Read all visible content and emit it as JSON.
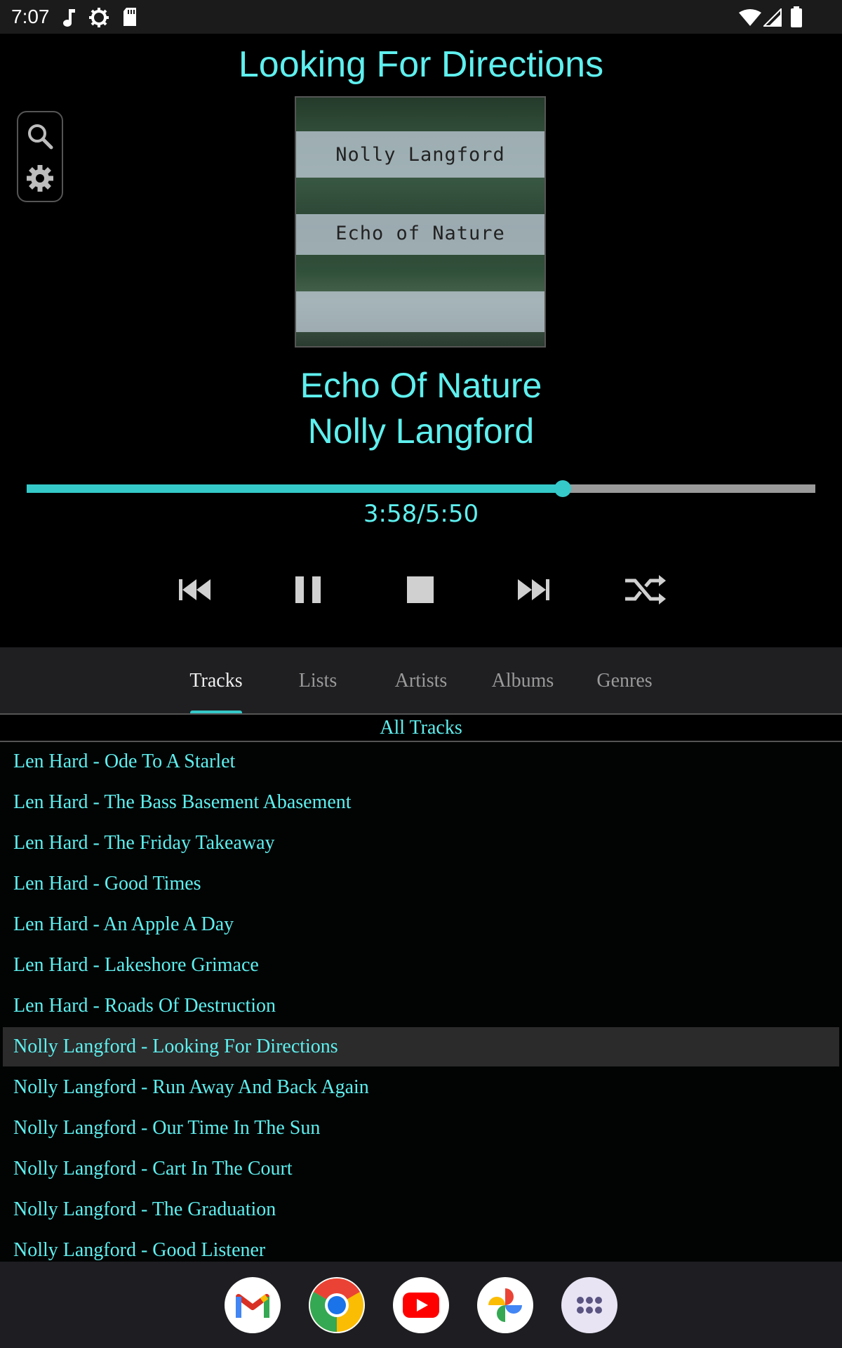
{
  "status_bar": {
    "time": "7:07",
    "left_icons": [
      "music-note-icon",
      "settings-gear-icon",
      "sd-card-icon"
    ],
    "right_icons": [
      "wifi-icon",
      "cell-signal-icon",
      "battery-icon"
    ]
  },
  "now_playing": {
    "heading": "Looking For Directions",
    "album_art": {
      "text_line_1": "Nolly Langford",
      "text_line_2": "Echo of Nature"
    },
    "album": "Echo Of Nature",
    "artist": "Nolly Langford",
    "position_text": "3:58/5:50",
    "progress_fraction": 0.68
  },
  "side_tools": [
    "search-icon",
    "settings-icon"
  ],
  "controls": [
    "previous-icon",
    "pause-icon",
    "stop-icon",
    "next-icon",
    "shuffle-icon"
  ],
  "tabs": [
    {
      "label": "Tracks",
      "active": true
    },
    {
      "label": "Lists",
      "active": false
    },
    {
      "label": "Artists",
      "active": false
    },
    {
      "label": "Albums",
      "active": false
    },
    {
      "label": "Genres",
      "active": false
    }
  ],
  "list_header": "All Tracks",
  "tracks": [
    {
      "label": "Len Hard - Ode To A Starlet",
      "current": false
    },
    {
      "label": "Len Hard - The Bass Basement Abasement",
      "current": false
    },
    {
      "label": "Len Hard - The Friday Takeaway",
      "current": false
    },
    {
      "label": "Len Hard - Good Times",
      "current": false
    },
    {
      "label": "Len Hard - An Apple A Day",
      "current": false
    },
    {
      "label": "Len Hard - Lakeshore Grimace",
      "current": false
    },
    {
      "label": "Len Hard - Roads Of Destruction",
      "current": false
    },
    {
      "label": "Nolly Langford - Looking For Directions",
      "current": true
    },
    {
      "label": "Nolly Langford - Run Away And Back Again",
      "current": false
    },
    {
      "label": "Nolly Langford - Our Time In The Sun",
      "current": false
    },
    {
      "label": "Nolly Langford - Cart In The Court",
      "current": false
    },
    {
      "label": "Nolly Langford - The Graduation",
      "current": false
    },
    {
      "label": "Nolly Langford - Good Listener",
      "current": false
    }
  ],
  "dock_apps": [
    "gmail-icon",
    "chrome-icon",
    "youtube-icon",
    "photos-icon",
    "app-drawer-icon"
  ],
  "colors": {
    "accent": "#5ef0ef",
    "seek_fill": "#35c9c9",
    "background": "#000000",
    "current_row": "#2b2b2b"
  }
}
